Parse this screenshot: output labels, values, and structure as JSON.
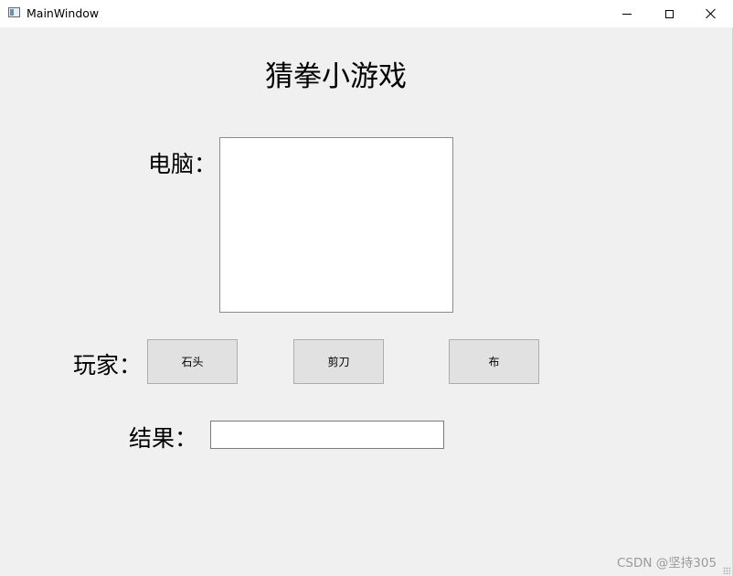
{
  "window": {
    "title": "MainWindow",
    "icon": "app-window-icon",
    "controls": {
      "minimize": "minimize-icon",
      "maximize": "maximize-icon",
      "close": "close-icon"
    }
  },
  "main": {
    "heading": "猜拳小游戏",
    "computer_label": "电脑：",
    "player_label": "玩家：",
    "result_label": "结果：",
    "result_value": "",
    "buttons": {
      "rock": "石头",
      "scissors": "剪刀",
      "paper": "布"
    }
  },
  "watermark": "CSDN @坚持305",
  "colors": {
    "background": "#f0f0f0",
    "titlebar": "#ffffff",
    "button": "#e1e1e1",
    "button_border": "#adadad"
  }
}
